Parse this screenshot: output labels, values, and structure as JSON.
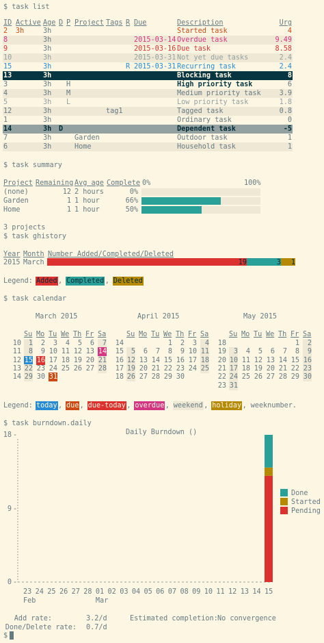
{
  "prompts": {
    "task_list": "$ task list",
    "task_summary": "$ task summary",
    "task_ghistory": "$ task ghistory",
    "task_calendar": "$ task calendar",
    "task_burndown": "$ task burndown.daily",
    "final_prompt": "$"
  },
  "task_list": {
    "headers": [
      "ID",
      "Active",
      "Age",
      "D",
      "P",
      "Project",
      "Tags",
      "R",
      "Due",
      "Description",
      "Urg"
    ],
    "rows": [
      {
        "id": "2",
        "active": "3h",
        "age": "3h",
        "d": "",
        "p": "",
        "project": "",
        "tags": "",
        "r": "",
        "due": "",
        "description": "Started task",
        "urg": "4",
        "style": "orange"
      },
      {
        "id": "8",
        "active": "",
        "age": "3h",
        "d": "",
        "p": "",
        "project": "",
        "tags": "",
        "r": "",
        "due": "2015-03-14",
        "description": "Overdue task",
        "urg": "9.49",
        "style": "magenta"
      },
      {
        "id": "9",
        "active": "",
        "age": "3h",
        "d": "",
        "p": "",
        "project": "",
        "tags": "",
        "r": "",
        "due": "2015-03-16",
        "description": "Due task",
        "urg": "8.58",
        "style": "red"
      },
      {
        "id": "10",
        "active": "",
        "age": "3h",
        "d": "",
        "p": "",
        "project": "",
        "tags": "",
        "r": "",
        "due": "2015-03-31",
        "description": "Not yet due tasks",
        "urg": "2.4",
        "style": "gray"
      },
      {
        "id": "15",
        "active": "",
        "age": "3h",
        "d": "",
        "p": "",
        "project": "",
        "tags": "",
        "r": "R",
        "due": "2015-03-31",
        "description": "Recurring task",
        "urg": "2.4",
        "style": "blue"
      },
      {
        "id": "13",
        "active": "",
        "age": "3h",
        "d": "",
        "p": "",
        "project": "",
        "tags": "",
        "r": "",
        "due": "",
        "description": "Blocking task",
        "urg": "8",
        "style": "sel"
      },
      {
        "id": "3",
        "active": "",
        "age": "3h",
        "d": "",
        "p": "H",
        "project": "",
        "tags": "",
        "r": "",
        "due": "",
        "description": "High priority task",
        "urg": "6",
        "style": "bold"
      },
      {
        "id": "4",
        "active": "",
        "age": "3h",
        "d": "",
        "p": "M",
        "project": "",
        "tags": "",
        "r": "",
        "due": "",
        "description": "Medium priority task",
        "urg": "3.9",
        "style": "normal"
      },
      {
        "id": "5",
        "active": "",
        "age": "3h",
        "d": "",
        "p": "L",
        "project": "",
        "tags": "",
        "r": "",
        "due": "",
        "description": "Low priority task",
        "urg": "1.8",
        "style": "gray"
      },
      {
        "id": "12",
        "active": "",
        "age": "3h",
        "d": "",
        "p": "",
        "project": "",
        "tags": "tag1",
        "r": "",
        "due": "",
        "description": "Tagged task",
        "urg": "0.8",
        "style": "normal"
      },
      {
        "id": "1",
        "active": "",
        "age": "3h",
        "d": "",
        "p": "",
        "project": "",
        "tags": "",
        "r": "",
        "due": "",
        "description": "Ordinary task",
        "urg": "0",
        "style": "normal"
      },
      {
        "id": "14",
        "active": "",
        "age": "3h",
        "d": "D",
        "p": "",
        "project": "",
        "tags": "",
        "r": "",
        "due": "",
        "description": "Dependent task",
        "urg": "-5",
        "style": "sel2"
      },
      {
        "id": "7",
        "active": "",
        "age": "3h",
        "d": "",
        "p": "",
        "project": "Garden",
        "tags": "",
        "r": "",
        "due": "",
        "description": "Outdoor task",
        "urg": "1",
        "style": "normal"
      },
      {
        "id": "6",
        "active": "",
        "age": "3h",
        "d": "",
        "p": "",
        "project": "Home",
        "tags": "",
        "r": "",
        "due": "",
        "description": "Household task",
        "urg": "1",
        "style": "normal"
      }
    ]
  },
  "summary": {
    "headers": [
      "Project",
      "Remaining",
      "Avg age",
      "Complete",
      "0%",
      "100%"
    ],
    "rows": [
      {
        "project": "(none)",
        "remaining": "12",
        "avg_age": "2 hours",
        "complete": "0%",
        "fraction": 0
      },
      {
        "project": "Garden",
        "remaining": "1",
        "avg_age": "1 hour",
        "complete": "66%",
        "fraction": 0.66
      },
      {
        "project": "Home",
        "remaining": "1",
        "avg_age": "1 hour",
        "complete": "50%",
        "fraction": 0.5
      }
    ],
    "footer": "3 projects"
  },
  "ghistory": {
    "headers": [
      "Year",
      "Month",
      "Number Added/Completed/Deleted"
    ],
    "row": {
      "year": "2015",
      "month": "March",
      "added": 19,
      "completed": 3,
      "deleted": 1,
      "added_label": "19",
      "completed_label": "3",
      "deleted_label": "1"
    },
    "legend_label": "Legend:",
    "legend": [
      {
        "label": "Added",
        "color": "#dc322f"
      },
      {
        "label": "Completed",
        "color": "#2aa198"
      },
      {
        "label": "Deleted",
        "color": "#b58900"
      }
    ]
  },
  "calendar": {
    "weekday_headers": [
      "Su",
      "Mo",
      "Tu",
      "We",
      "Th",
      "Fr",
      "Sa"
    ],
    "months": [
      {
        "title": "March 2015",
        "weeks": [
          {
            "wk": "10",
            "days": [
              "1",
              "2",
              "3",
              "4",
              "5",
              "6",
              "7"
            ]
          },
          {
            "wk": "11",
            "days": [
              "8",
              "9",
              "10",
              "11",
              "12",
              "13",
              "14"
            ]
          },
          {
            "wk": "12",
            "days": [
              "15",
              "16",
              "17",
              "18",
              "19",
              "20",
              "21"
            ]
          },
          {
            "wk": "13",
            "days": [
              "22",
              "23",
              "24",
              "25",
              "26",
              "27",
              "28"
            ]
          },
          {
            "wk": "14",
            "days": [
              "29",
              "30",
              "31",
              "",
              "",
              "",
              ""
            ]
          }
        ]
      },
      {
        "title": "April 2015",
        "weeks": [
          {
            "wk": "14",
            "days": [
              "",
              "",
              "",
              "1",
              "2",
              "3",
              "4"
            ]
          },
          {
            "wk": "15",
            "days": [
              "5",
              "6",
              "7",
              "8",
              "9",
              "10",
              "11"
            ]
          },
          {
            "wk": "16",
            "days": [
              "12",
              "13",
              "14",
              "15",
              "16",
              "17",
              "18"
            ]
          },
          {
            "wk": "17",
            "days": [
              "19",
              "20",
              "21",
              "22",
              "23",
              "24",
              "25"
            ]
          },
          {
            "wk": "18",
            "days": [
              "26",
              "27",
              "28",
              "29",
              "30",
              "",
              ""
            ]
          }
        ]
      },
      {
        "title": "May 2015",
        "weeks": [
          {
            "wk": "18",
            "days": [
              "",
              "",
              "",
              "",
              "",
              "1",
              "2"
            ]
          },
          {
            "wk": "19",
            "days": [
              "3",
              "4",
              "5",
              "6",
              "7",
              "8",
              "9"
            ]
          },
          {
            "wk": "20",
            "days": [
              "10",
              "11",
              "12",
              "13",
              "14",
              "15",
              "16"
            ]
          },
          {
            "wk": "21",
            "days": [
              "17",
              "18",
              "19",
              "20",
              "21",
              "22",
              "23"
            ]
          },
          {
            "wk": "22",
            "days": [
              "24",
              "25",
              "26",
              "27",
              "28",
              "29",
              "30"
            ]
          },
          {
            "wk": "23",
            "days": [
              "31",
              "",
              "",
              "",
              "",
              "",
              ""
            ]
          }
        ]
      }
    ],
    "legend_label": "Legend:",
    "legend": [
      {
        "label": "today",
        "bg": "#268bd2",
        "fg": "#fdf6e3"
      },
      {
        "label": "due",
        "bg": "#cb4b16",
        "fg": "#fdf6e3"
      },
      {
        "label": "due-today",
        "bg": "#dc322f",
        "fg": "#fdf6e3"
      },
      {
        "label": "overdue",
        "bg": "#d33682",
        "fg": "#fdf6e3"
      },
      {
        "label": "weekend",
        "bg": "#eee8d5",
        "fg": "#657b83"
      },
      {
        "label": "holiday",
        "bg": "#b58900",
        "fg": "#fdf6e3"
      },
      {
        "label": "weeknumber.",
        "bg": "",
        "fg": "#657b83"
      }
    ]
  },
  "chart_data": {
    "type": "bar",
    "title": "Daily Burndown ()",
    "categories": [
      "23",
      "24",
      "25",
      "26",
      "27",
      "28",
      "01",
      "02",
      "03",
      "04",
      "05",
      "06",
      "07",
      "08",
      "09",
      "10",
      "11",
      "12",
      "13",
      "14",
      "15"
    ],
    "month_labels": [
      {
        "label": "Feb",
        "at": "23"
      },
      {
        "label": "Mar",
        "at": "01"
      }
    ],
    "series": [
      {
        "name": "Pending",
        "color": "#dc322f",
        "values": [
          0,
          0,
          0,
          0,
          0,
          0,
          0,
          0,
          0,
          0,
          0,
          0,
          0,
          0,
          0,
          0,
          0,
          0,
          0,
          0,
          13
        ]
      },
      {
        "name": "Started",
        "color": "#b58900",
        "values": [
          0,
          0,
          0,
          0,
          0,
          0,
          0,
          0,
          0,
          0,
          0,
          0,
          0,
          0,
          0,
          0,
          0,
          0,
          0,
          0,
          1
        ]
      },
      {
        "name": "Done",
        "color": "#2aa198",
        "values": [
          0,
          0,
          0,
          0,
          0,
          0,
          0,
          0,
          0,
          0,
          0,
          0,
          0,
          0,
          0,
          0,
          0,
          0,
          0,
          0,
          4
        ]
      }
    ],
    "legend_order": [
      "Done",
      "Started",
      "Pending"
    ],
    "y_ticks": [
      "18",
      "9",
      "0"
    ],
    "ylim": [
      0,
      18
    ],
    "stats": {
      "add_rate_label": "Add rate:",
      "add_rate": "3.2/d",
      "done_rate_label": "Done/Delete rate:",
      "done_rate": "0.7/d",
      "completion_label": "Estimated completion:",
      "completion": "No convergence"
    }
  }
}
